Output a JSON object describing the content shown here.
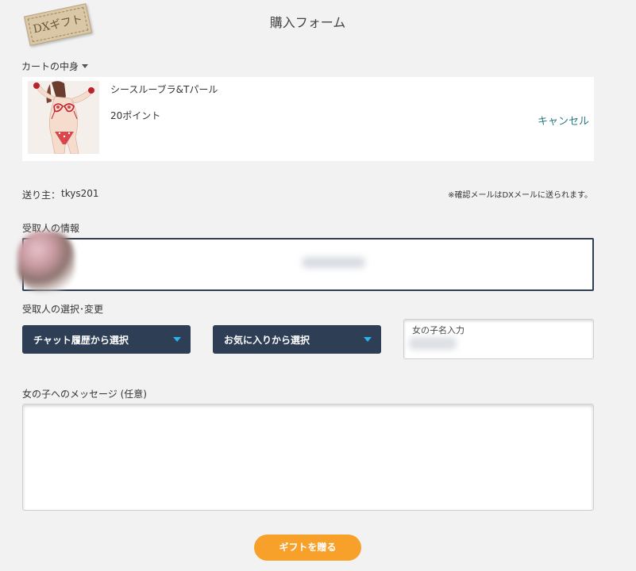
{
  "logo": {
    "text": "DXギフト"
  },
  "page": {
    "title": "購入フォーム"
  },
  "cart": {
    "toggle_label": "カートの中身",
    "item": {
      "name": "シースルーブラ&Tパール",
      "points": "20ポイント",
      "cancel_label": "キャンセル"
    }
  },
  "sender": {
    "label": "送り主：",
    "name": "tkys201",
    "mail_note": "※確認メールはDXメールに送られます。"
  },
  "recipient": {
    "heading": "受取人の情報"
  },
  "selection": {
    "heading": "受取人の選択･変更",
    "chat_history_label": "チャット履歴から選択",
    "favorites_label": "お気に入りから選択",
    "girl_name_label": "女の子名入力"
  },
  "message": {
    "heading": "女の子へのメッセージ (任意)",
    "value": ""
  },
  "submit": {
    "label": "ギフトを贈る"
  },
  "colors": {
    "navy": "#2d3e55",
    "accent_orange": "#f7a12a",
    "link_teal": "#2a7a82",
    "arrow_cyan": "#27b4e8"
  }
}
